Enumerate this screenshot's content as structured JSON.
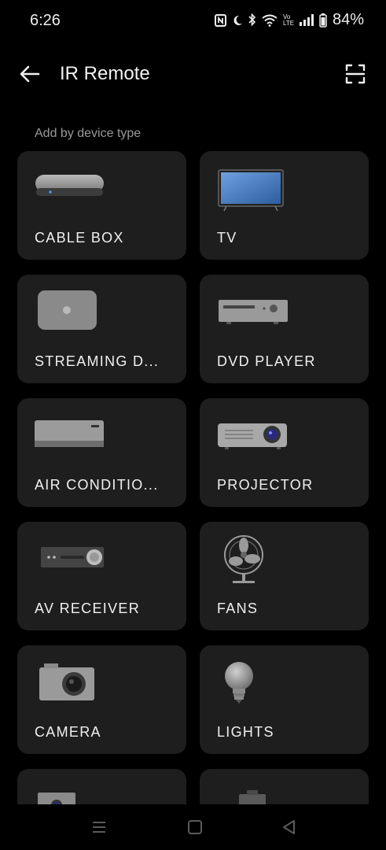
{
  "status_bar": {
    "time": "6:26",
    "volte": "Vo LTE",
    "battery_percent": "84%"
  },
  "app_bar": {
    "title": "IR Remote"
  },
  "section_label": "Add by device type",
  "devices": [
    {
      "label": "CABLE BOX",
      "icon": "cable-box-icon"
    },
    {
      "label": "TV",
      "icon": "tv-icon"
    },
    {
      "label": "STREAMING D...",
      "icon": "streaming-device-icon"
    },
    {
      "label": "DVD PLAYER",
      "icon": "dvd-player-icon"
    },
    {
      "label": "AIR CONDITIO...",
      "icon": "air-conditioner-icon"
    },
    {
      "label": "PROJECTOR",
      "icon": "projector-icon"
    },
    {
      "label": "AV RECEIVER",
      "icon": "av-receiver-icon"
    },
    {
      "label": "FANS",
      "icon": "fan-icon"
    },
    {
      "label": "CAMERA",
      "icon": "camera-icon"
    },
    {
      "label": "LIGHTS",
      "icon": "light-bulb-icon"
    },
    {
      "label": "",
      "icon": "webcam-icon"
    },
    {
      "label": "",
      "icon": "device-icon"
    }
  ],
  "colors": {
    "background": "#000000",
    "card": "#1e1e1e",
    "tv_screen": "#4a7fc4"
  }
}
